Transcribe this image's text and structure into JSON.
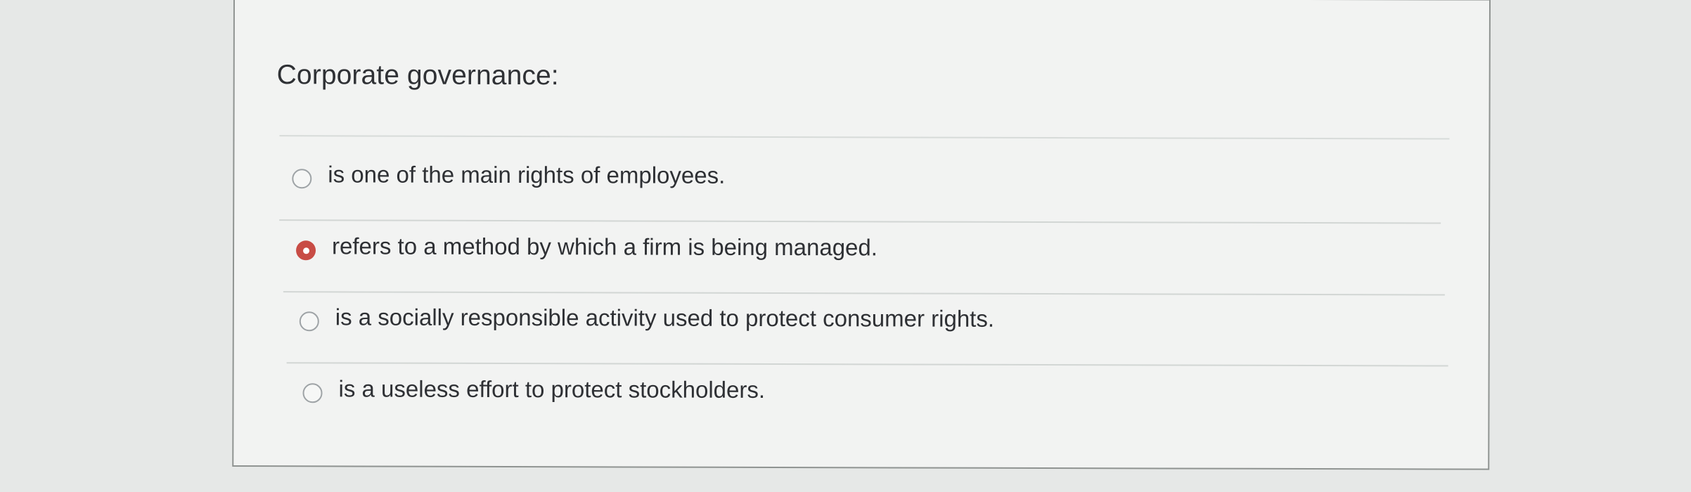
{
  "question": {
    "title": "Corporate governance:",
    "choices": [
      {
        "label": "is one of the main rights of employees.",
        "selected": false
      },
      {
        "label": "refers to a method by which a firm is being managed.",
        "selected": true
      },
      {
        "label": "is a socially responsible activity used to protect consumer rights.",
        "selected": false
      },
      {
        "label": "is a useless effort to protect stockholders.",
        "selected": false
      }
    ]
  },
  "colors": {
    "selected_radio": "#c84c45",
    "card_background": "#f2f3f2",
    "page_background": "#e6e8e7"
  },
  "icons": {
    "unselected": "radio-unselected-icon",
    "selected": "radio-selected-icon"
  }
}
